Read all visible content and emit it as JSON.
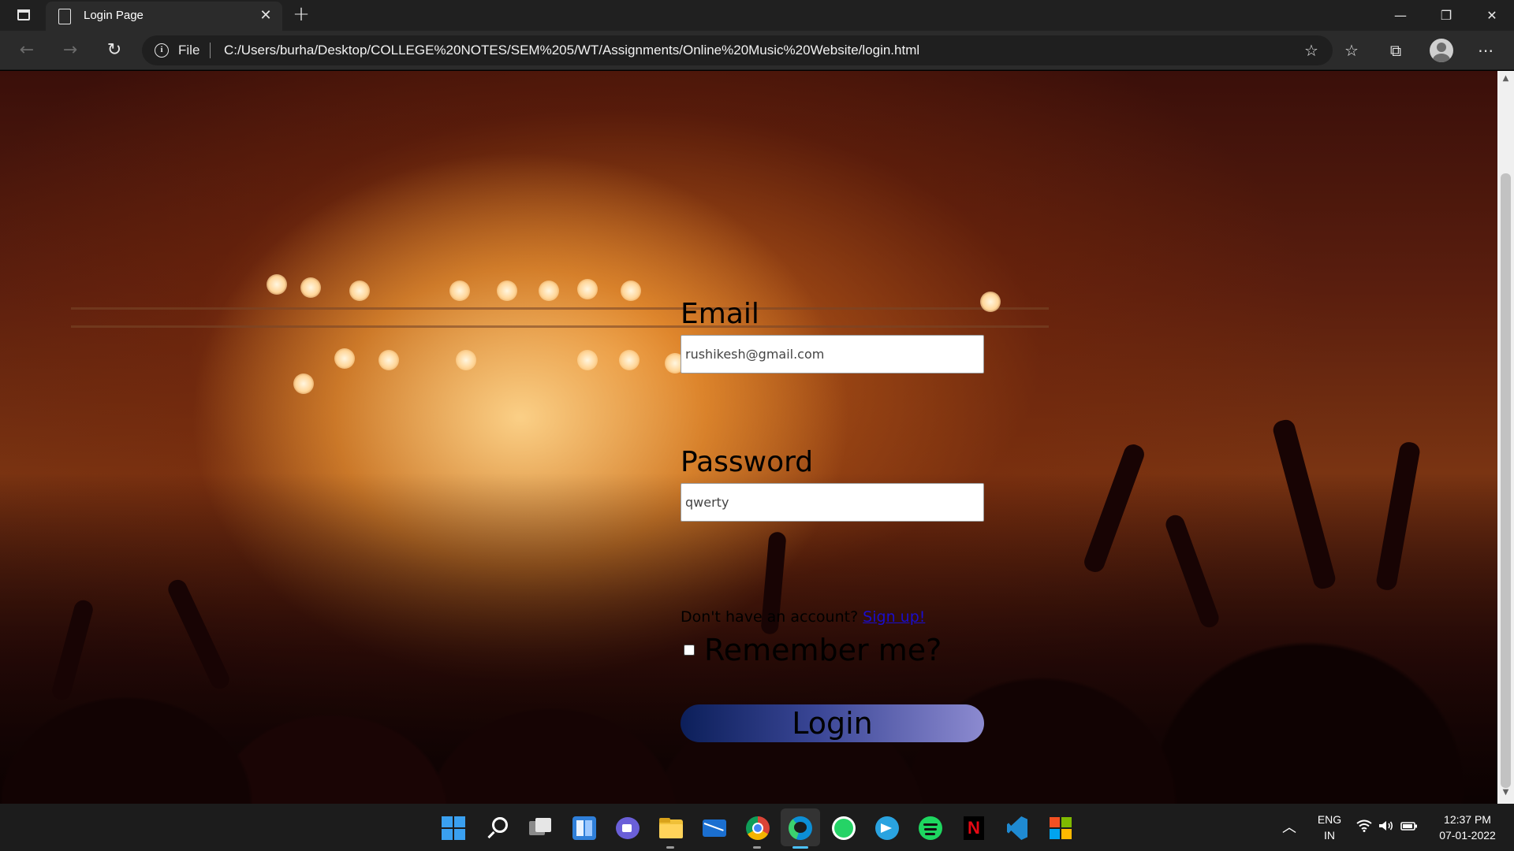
{
  "browser": {
    "tab_title": "Login Page",
    "file_label": "File",
    "url": "C:/Users/burha/Desktop/COLLEGE%20NOTES/SEM%205/WT/Assignments/Online%20Music%20Website/login.html",
    "icons": [
      "sidebar-icon",
      "page-icon",
      "close-icon",
      "plus-icon",
      "minimize-icon",
      "restore-icon",
      "close-window-icon",
      "back-icon",
      "forward-icon",
      "refresh-icon",
      "info-icon",
      "add-favorite-icon",
      "favorites-icon",
      "collections-icon",
      "profile-icon",
      "more-icon"
    ]
  },
  "form": {
    "email_label": "Email",
    "email_value": "rushikesh@gmail.com",
    "password_label": "Password",
    "password_value": "qwerty",
    "signup_prompt": "Don't have an account?",
    "signup_link": "Sign up!",
    "remember_label": "Remember me?",
    "login_button": "Login",
    "button_gradient": [
      "#0c1f5a",
      "#8c8ad0"
    ]
  },
  "taskbar": {
    "language": "ENG",
    "region": "IN",
    "time": "12:37 PM",
    "date": "07-01-2022",
    "apps": [
      "start",
      "search",
      "task-view",
      "widgets",
      "chat",
      "file-explorer",
      "mail",
      "chrome",
      "edge",
      "whatsapp",
      "telegram",
      "spotify",
      "netflix",
      "vscode",
      "other-app"
    ]
  }
}
